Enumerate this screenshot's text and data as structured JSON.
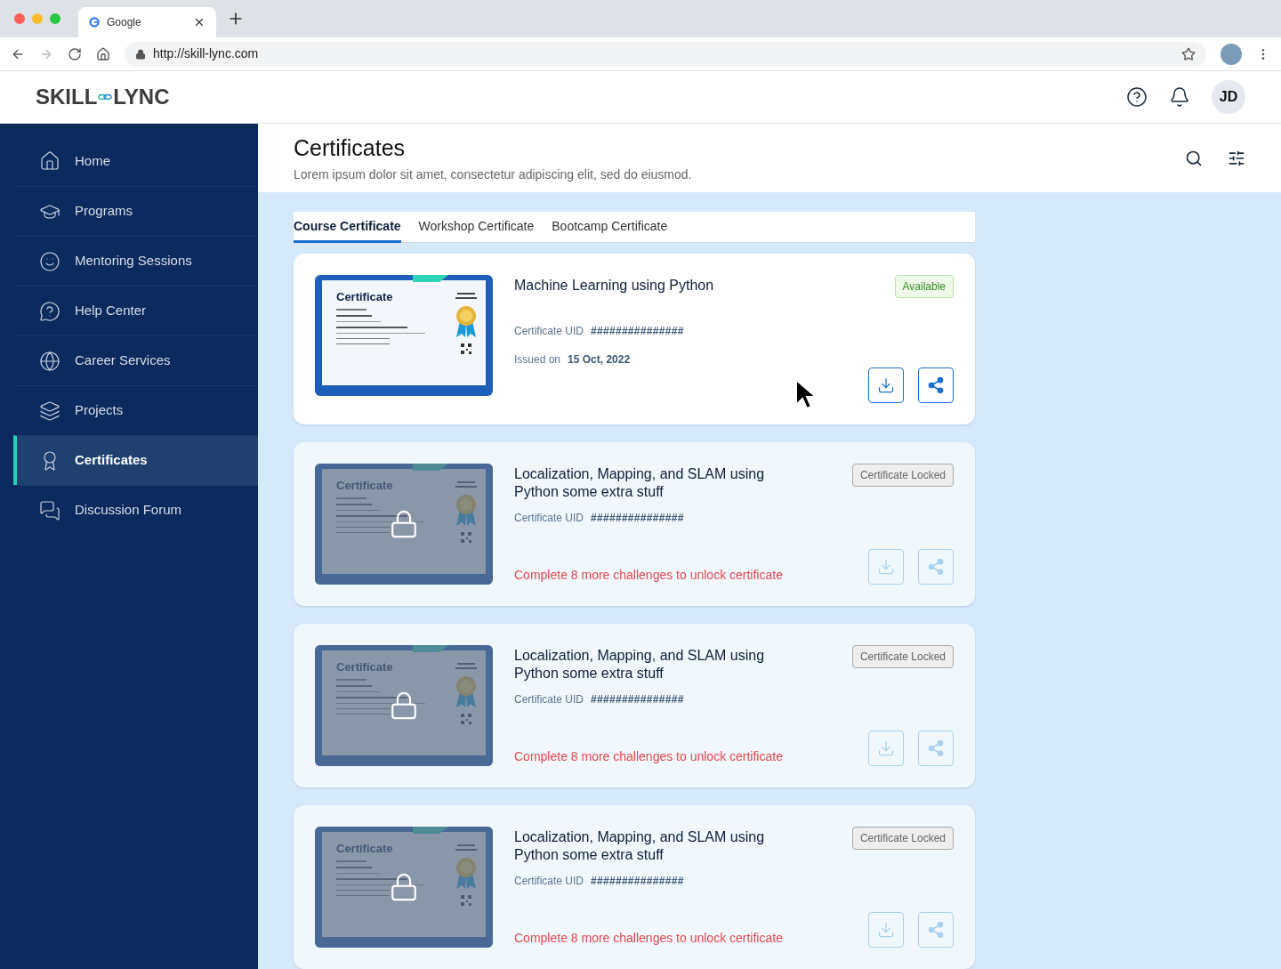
{
  "browser": {
    "tab_title": "Google",
    "url": "http://skill-lync.com"
  },
  "header": {
    "logo_left": "SKILL",
    "logo_right": "LYNC",
    "avatar_initials": "JD"
  },
  "sidebar": {
    "items": [
      {
        "label": "Home",
        "selected": false
      },
      {
        "label": "Programs",
        "selected": false
      },
      {
        "label": "Mentoring Sessions",
        "selected": false
      },
      {
        "label": "Help Center",
        "selected": false
      },
      {
        "label": "Career Services",
        "selected": false
      },
      {
        "label": "Projects",
        "selected": false
      },
      {
        "label": "Certificates",
        "selected": true
      },
      {
        "label": "Discussion Forum",
        "selected": false
      }
    ]
  },
  "page": {
    "title": "Certificates",
    "subtitle": "Lorem ipsum dolor sit amet, consectetur adipiscing elit, sed do eiusmod."
  },
  "tabs": [
    {
      "label": "Course Certificate",
      "selected": true
    },
    {
      "label": "Workshop Certificate",
      "selected": false
    },
    {
      "label": "Bootcamp Certificate",
      "selected": false
    }
  ],
  "certificates": [
    {
      "kind": "available",
      "title": "Machine Learning using Python",
      "badge": "Available",
      "uid_label": "Certificate UID",
      "uid": "###############",
      "issued_label": "Issued on",
      "issued": "15 Oct, 2022",
      "thumb": {
        "heading": "Certificate"
      }
    },
    {
      "kind": "locked",
      "title": "Localization, Mapping, and SLAM using Python some extra stuff",
      "badge": "Certificate Locked",
      "uid_label": "Certificate UID",
      "uid": "###############",
      "hint": "Complete 8 more challenges to unlock certificate",
      "thumb": {
        "heading": "Certificate"
      }
    },
    {
      "kind": "locked",
      "title": "Localization, Mapping, and SLAM using Python some extra stuff",
      "badge": "Certificate Locked",
      "uid_label": "Certificate UID",
      "uid": "###############",
      "hint": "Complete 8 more challenges to unlock certificate",
      "thumb": {
        "heading": "Certificate"
      }
    },
    {
      "kind": "locked",
      "title": "Localization, Mapping, and SLAM using Python some extra stuff",
      "badge": "Certificate Locked",
      "uid_label": "Certificate UID",
      "uid": "###############",
      "hint": "Complete 8 more challenges to unlock certificate",
      "thumb": {
        "heading": "Certificate"
      }
    }
  ]
}
